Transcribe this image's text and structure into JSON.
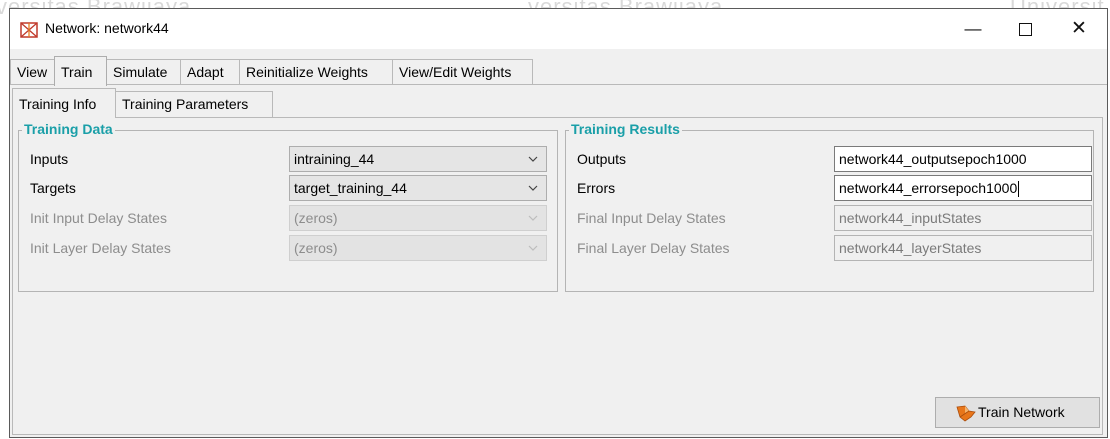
{
  "watermark": [
    "versitas Brawijaya",
    "versitas Brawijaya",
    "Universit"
  ],
  "window": {
    "title": "Network: network44",
    "controls": {
      "minimize": "—",
      "close": "✕"
    }
  },
  "main_tabs": [
    "View",
    "Train",
    "Simulate",
    "Adapt",
    "Reinitialize Weights",
    "View/Edit Weights"
  ],
  "sub_tabs": [
    "Training Info",
    "Training Parameters"
  ],
  "training_data": {
    "title": "Training Data",
    "inputs": {
      "label": "Inputs",
      "value": "intraining_44"
    },
    "targets": {
      "label": "Targets",
      "value": "target_training_44"
    },
    "init_input_delay": {
      "label": "Init Input Delay States",
      "value": "(zeros)"
    },
    "init_layer_delay": {
      "label": "Init Layer Delay States",
      "value": "(zeros)"
    }
  },
  "training_results": {
    "title": "Training Results",
    "outputs": {
      "label": "Outputs",
      "value": "network44_outputsepoch1000"
    },
    "errors": {
      "label": "Errors",
      "value": "network44_errorsepoch1000"
    },
    "final_input_delay": {
      "label": "Final Input Delay States",
      "value": "network44_inputStates"
    },
    "final_layer_delay": {
      "label": "Final Layer Delay States",
      "value": "network44_layerStates"
    }
  },
  "train_button": {
    "label": "Train Network"
  },
  "colors": {
    "group_title": "#1a9fa8",
    "window_bg": "#f0f0f0",
    "icon_accent": "#e8761a"
  }
}
